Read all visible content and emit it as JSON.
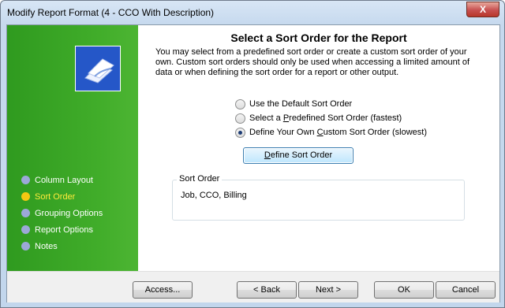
{
  "window": {
    "title": "Modify Report Format (4 - CCO With Description)",
    "close_label": "X"
  },
  "sidebar": {
    "logo_icon": "report-document-icon",
    "items": [
      {
        "label": "Column Layout",
        "active": false
      },
      {
        "label": "Sort Order",
        "active": true
      },
      {
        "label": "Grouping Options",
        "active": false
      },
      {
        "label": "Report Options",
        "active": false
      },
      {
        "label": "Notes",
        "active": false
      }
    ]
  },
  "main": {
    "heading": "Select a Sort Order for the Report",
    "description": "You may select from a predefined sort order or create a custom sort order of your own. Custom sort orders should only be used when accessing a limited amount of data or when defining the sort order for a report or other output.",
    "options": [
      {
        "pre": "Use the Default Sort Order",
        "u": "",
        "post": "",
        "checked": false
      },
      {
        "pre": "Select a ",
        "u": "P",
        "post": "redefined Sort Order (fastest)",
        "checked": false
      },
      {
        "pre": "Define Your Own ",
        "u": "C",
        "post": "ustom Sort Order (slowest)",
        "checked": true
      }
    ],
    "define_button": {
      "u": "D",
      "rest": "efine Sort Order"
    },
    "sort_order": {
      "legend": "Sort Order",
      "value": "Job,  CCO, Billing"
    }
  },
  "footer": {
    "access": "Access...",
    "back": "< Back",
    "next": "Next >",
    "ok": "OK",
    "cancel": "Cancel"
  },
  "colors": {
    "sidebar_green": "#41ad2a",
    "active_nav": "#ffeb3b",
    "inactive_dot": "#9ca8d8"
  }
}
